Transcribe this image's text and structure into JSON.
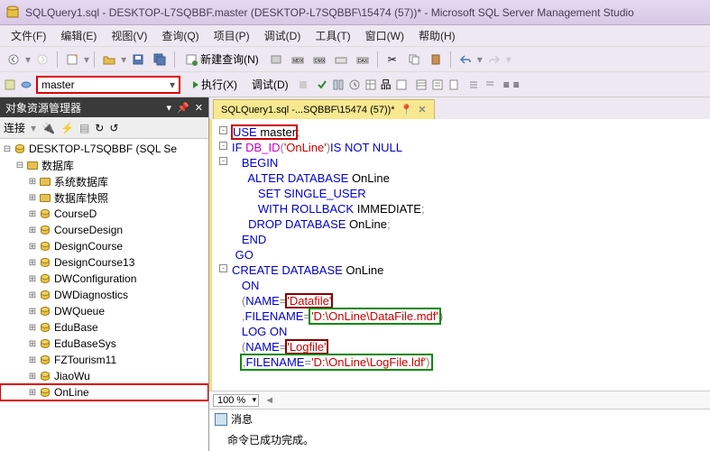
{
  "window": {
    "title": "SQLQuery1.sql - DESKTOP-L7SQBBF.master (DESKTOP-L7SQBBF\\15474 (57))* - Microsoft SQL Server Management Studio"
  },
  "menu": {
    "file": "文件(F)",
    "edit": "编辑(E)",
    "view": "视图(V)",
    "query": "查询(Q)",
    "project": "项目(P)",
    "debug": "调试(D)",
    "tools": "工具(T)",
    "window": "窗口(W)",
    "help": "帮助(H)"
  },
  "toolbar": {
    "new_query": "新建查询(N)"
  },
  "toolbar2": {
    "database": "master",
    "execute": "执行(X)",
    "debug": "调试(D)"
  },
  "sidebar": {
    "title": "对象资源管理器",
    "connect_label": "连接",
    "server": "DESKTOP-L7SQBBF (SQL Se",
    "databases_folder": "数据库",
    "sys_db": "系统数据库",
    "db_snapshot": "数据库快照",
    "dbs": [
      "CourseD",
      "CourseDesign",
      "DesignCourse",
      "DesignCourse13",
      "DWConfiguration",
      "DWDiagnostics",
      "DWQueue",
      "EduBase",
      "EduBaseSys",
      "FZTourism11",
      "JiaoWu",
      "OnLine"
    ]
  },
  "tab": {
    "label": "SQLQuery1.sql -...SQBBF\\15474 (57))*"
  },
  "code": {
    "l1a": "USE",
    "l1b": " master",
    "l2a": "IF ",
    "l2b": "DB_ID",
    "l2c": "(",
    "l2d": "'OnLine'",
    "l2e": ")",
    "l2f": "IS NOT NULL",
    "l3": "BEGIN",
    "l4a": "ALTER DATABASE",
    "l4b": " OnLine",
    "l5": "SET SINGLE_USER",
    "l6a": "WITH ROLLBACK",
    "l6b": " IMMEDIATE",
    "l7a": "DROP DATABASE",
    "l7b": " OnLine",
    "l8": "END",
    "l9": "GO",
    "l10a": "CREATE DATABASE",
    "l10b": " OnLine",
    "l11": "ON",
    "l12a": "(",
    "l12b": "NAME",
    "l12c": "=",
    "l12d": "'Datafile'",
    "l13a": ",",
    "l13b": "FILENAME",
    "l13c": "=",
    "l13d": "'D:\\OnLine\\DataFile.mdf'",
    "l13e": ")",
    "l14": "LOG ON",
    "l15a": "(",
    "l15b": "NAME",
    "l15c": "=",
    "l15d": "'Logfile'",
    "l16a": ",",
    "l16b": "FILENAME",
    "l16c": "=",
    "l16d": "'D:\\OnLine\\LogFile.ldf'",
    "l16e": ")",
    "l16f": ";"
  },
  "zoom": "100 %",
  "messages": {
    "tab": "消息",
    "body": "命令已成功完成。"
  }
}
